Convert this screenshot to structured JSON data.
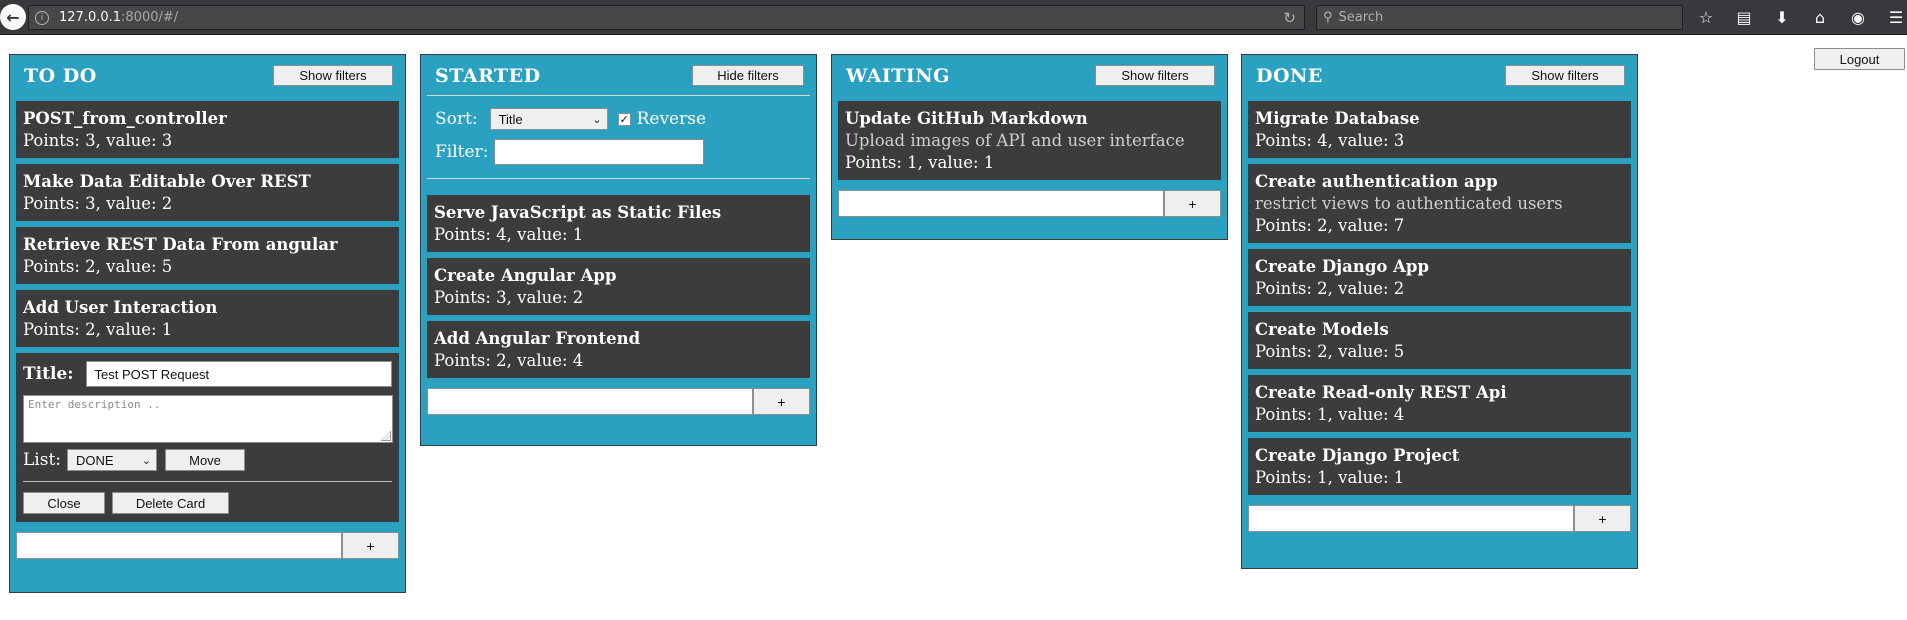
{
  "browser": {
    "url_host": "127.0.0.1",
    "url_path": ":8000/#/",
    "search_placeholder": "Search"
  },
  "logout_label": "Logout",
  "add_button_label": "+",
  "columns": {
    "todo": {
      "title": "TO DO",
      "filter_button": "Show filters",
      "cards": [
        {
          "title": "POST_from_controller",
          "meta": "Points: 3, value: 3"
        },
        {
          "title": "Make Data Editable Over REST",
          "meta": "Points: 3, value: 2"
        },
        {
          "title": "Retrieve REST Data From angular",
          "meta": "Points: 2, value: 5"
        },
        {
          "title": "Add User Interaction",
          "meta": "Points: 2, value: 1"
        }
      ],
      "edit_form": {
        "title_label": "Title:",
        "title_value": "Test POST Request",
        "description_placeholder": "Enter description ..",
        "list_label": "List:",
        "list_selected": "DONE",
        "move_label": "Move",
        "close_label": "Close",
        "delete_label": "Delete Card"
      }
    },
    "started": {
      "title": "STARTED",
      "filter_button": "Hide filters",
      "sort_label": "Sort:",
      "sort_selected": "Title",
      "reverse_label": "Reverse",
      "reverse_checked": true,
      "filter_label": "Filter:",
      "cards": [
        {
          "title": "Serve JavaScript as Static Files",
          "meta": "Points: 4, value: 1"
        },
        {
          "title": "Create Angular App",
          "meta": "Points: 3, value: 2"
        },
        {
          "title": "Add Angular Frontend",
          "meta": "Points: 2, value: 4"
        }
      ]
    },
    "waiting": {
      "title": "WAITING",
      "filter_button": "Show filters",
      "cards": [
        {
          "title": "Update GitHub Markdown",
          "description": "Upload images of API and user interface",
          "meta": "Points: 1, value: 1"
        }
      ]
    },
    "done": {
      "title": "DONE",
      "filter_button": "Show filters",
      "cards": [
        {
          "title": "Migrate Database",
          "meta": "Points: 4, value: 3"
        },
        {
          "title": "Create authentication app",
          "description": "restrict views to authenticated users",
          "meta": "Points: 2, value: 7"
        },
        {
          "title": "Create Django App",
          "meta": "Points: 2, value: 2"
        },
        {
          "title": "Create Models",
          "meta": "Points: 2, value: 5"
        },
        {
          "title": "Create Read-only REST Api",
          "meta": "Points: 1, value: 4"
        },
        {
          "title": "Create Django Project",
          "meta": "Points: 1, value: 1"
        }
      ]
    }
  }
}
